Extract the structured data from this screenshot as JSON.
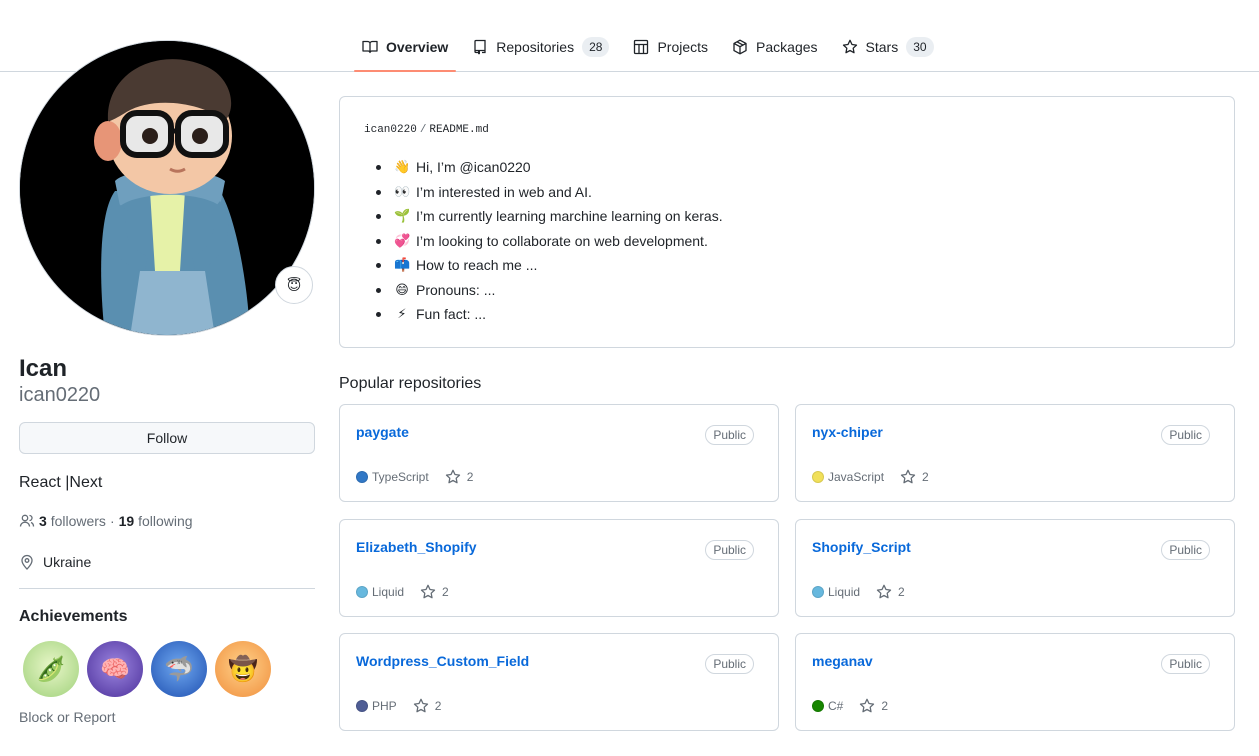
{
  "nav": {
    "tabs": [
      {
        "label": "Overview",
        "icon": "book-icon",
        "active": true
      },
      {
        "label": "Repositories",
        "icon": "repo-icon",
        "count": "28"
      },
      {
        "label": "Projects",
        "icon": "table-icon"
      },
      {
        "label": "Packages",
        "icon": "package-icon"
      },
      {
        "label": "Stars",
        "icon": "star-icon",
        "count": "30"
      }
    ]
  },
  "profile": {
    "name": "Ican",
    "login": "ican0220",
    "status_emoji": "😇",
    "follow_label": "Follow",
    "bio": "React |Next",
    "followers_count": "3",
    "followers_label": "followers",
    "separator": "·",
    "following_count": "19",
    "following_label": "following",
    "location": "Ukraine",
    "achievements_title": "Achievements",
    "achievements": [
      {
        "icon": "pair-extraordinaire-icon",
        "emoji": "🫛",
        "bg": "#c8e6a0"
      },
      {
        "icon": "galaxy-brain-icon",
        "emoji": "🧠",
        "bg": "#6b4fb8"
      },
      {
        "icon": "pull-shark-icon",
        "emoji": "🦈",
        "bg": "#2f6fd6"
      },
      {
        "icon": "yolo-icon",
        "emoji": "🤠",
        "bg": "#f6b35e"
      }
    ],
    "block_label": "Block or Report"
  },
  "readme": {
    "owner": "ican0220",
    "separator": "/",
    "file": "README.md",
    "items": [
      {
        "emoji": "👋",
        "text": "Hi, I’m @ican0220"
      },
      {
        "emoji": "👀",
        "text": "I’m interested in web and AI."
      },
      {
        "emoji": "🌱",
        "text": "I’m currently learning marchine learning on keras."
      },
      {
        "emoji": "💞",
        "text": "I’m looking to collaborate on web development."
      },
      {
        "emoji": "📫",
        "text": "How to reach me ..."
      },
      {
        "emoji": "😄",
        "text": "Pronouns: ..."
      },
      {
        "emoji": "⚡",
        "text": "Fun fact: ..."
      }
    ]
  },
  "popular": {
    "title": "Popular repositories",
    "repos": [
      {
        "name": "paygate",
        "visibility": "Public",
        "language": "TypeScript",
        "lang_color": "#3178c6",
        "stars": "2"
      },
      {
        "name": "nyx-chiper",
        "visibility": "Public",
        "language": "JavaScript",
        "lang_color": "#f1e05a",
        "stars": "2"
      },
      {
        "name": "Elizabeth_Shopify",
        "visibility": "Public",
        "language": "Liquid",
        "lang_color": "#67b8de",
        "stars": "2"
      },
      {
        "name": "Shopify_Script",
        "visibility": "Public",
        "language": "Liquid",
        "lang_color": "#67b8de",
        "stars": "2"
      },
      {
        "name": "Wordpress_Custom_Field",
        "visibility": "Public",
        "language": "PHP",
        "lang_color": "#4f5d95",
        "stars": "2"
      },
      {
        "name": "meganav",
        "visibility": "Public",
        "language": "C#",
        "lang_color": "#178600",
        "stars": "2"
      }
    ]
  },
  "colors": {
    "accent_link": "#0969da",
    "active_tab_underline": "#fd8c73",
    "border": "#d0d7de",
    "muted_text": "#656d76"
  }
}
